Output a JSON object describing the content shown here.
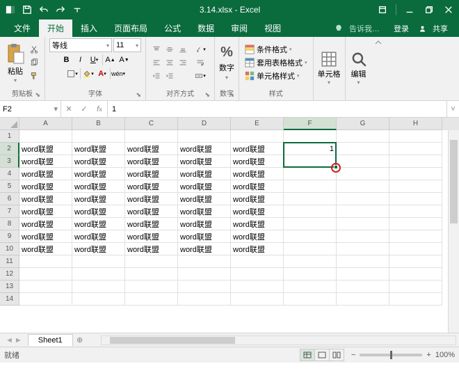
{
  "title": "3.14.xlsx - Excel",
  "tabs": [
    "文件",
    "开始",
    "插入",
    "页面布局",
    "公式",
    "数据",
    "审阅",
    "视图"
  ],
  "active_tab": 1,
  "tell_me": "告诉我…",
  "signin": "登录",
  "share": "共享",
  "clipboard": {
    "paste": "粘贴",
    "label": "剪贴板"
  },
  "font": {
    "name": "等线",
    "size": "11",
    "label": "字体"
  },
  "alignment_label": "对齐方式",
  "number": {
    "btn": "数字",
    "label": "数字"
  },
  "styles": {
    "cond": "条件格式",
    "table": "套用表格格式",
    "cell": "单元格样式",
    "label": "样式"
  },
  "cells_label": "单元格",
  "editing_label": "编辑",
  "namebox": "F2",
  "formula": "1",
  "columns": [
    "A",
    "B",
    "C",
    "D",
    "E",
    "F",
    "G",
    "H"
  ],
  "data_rows": [
    [
      "word联盟",
      "word联盟",
      "word联盟",
      "word联盟",
      "word联盟",
      "1",
      "",
      ""
    ],
    [
      "word联盟",
      "word联盟",
      "word联盟",
      "word联盟",
      "word联盟",
      "",
      "",
      ""
    ],
    [
      "word联盟",
      "word联盟",
      "word联盟",
      "word联盟",
      "word联盟",
      "",
      "",
      ""
    ],
    [
      "word联盟",
      "word联盟",
      "word联盟",
      "word联盟",
      "word联盟",
      "",
      "",
      ""
    ],
    [
      "word联盟",
      "word联盟",
      "word联盟",
      "word联盟",
      "word联盟",
      "",
      "",
      ""
    ],
    [
      "word联盟",
      "word联盟",
      "word联盟",
      "word联盟",
      "word联盟",
      "",
      "",
      ""
    ],
    [
      "word联盟",
      "word联盟",
      "word联盟",
      "word联盟",
      "word联盟",
      "",
      "",
      ""
    ],
    [
      "word联盟",
      "word联盟",
      "word联盟",
      "word联盟",
      "word联盟",
      "",
      "",
      ""
    ],
    [
      "word联盟",
      "word联盟",
      "word联盟",
      "word联盟",
      "word联盟",
      "",
      "",
      ""
    ]
  ],
  "row_start": 2,
  "total_visible_rows": 14,
  "sheet_name": "Sheet1",
  "status_text": "就绪",
  "zoom": "100%"
}
